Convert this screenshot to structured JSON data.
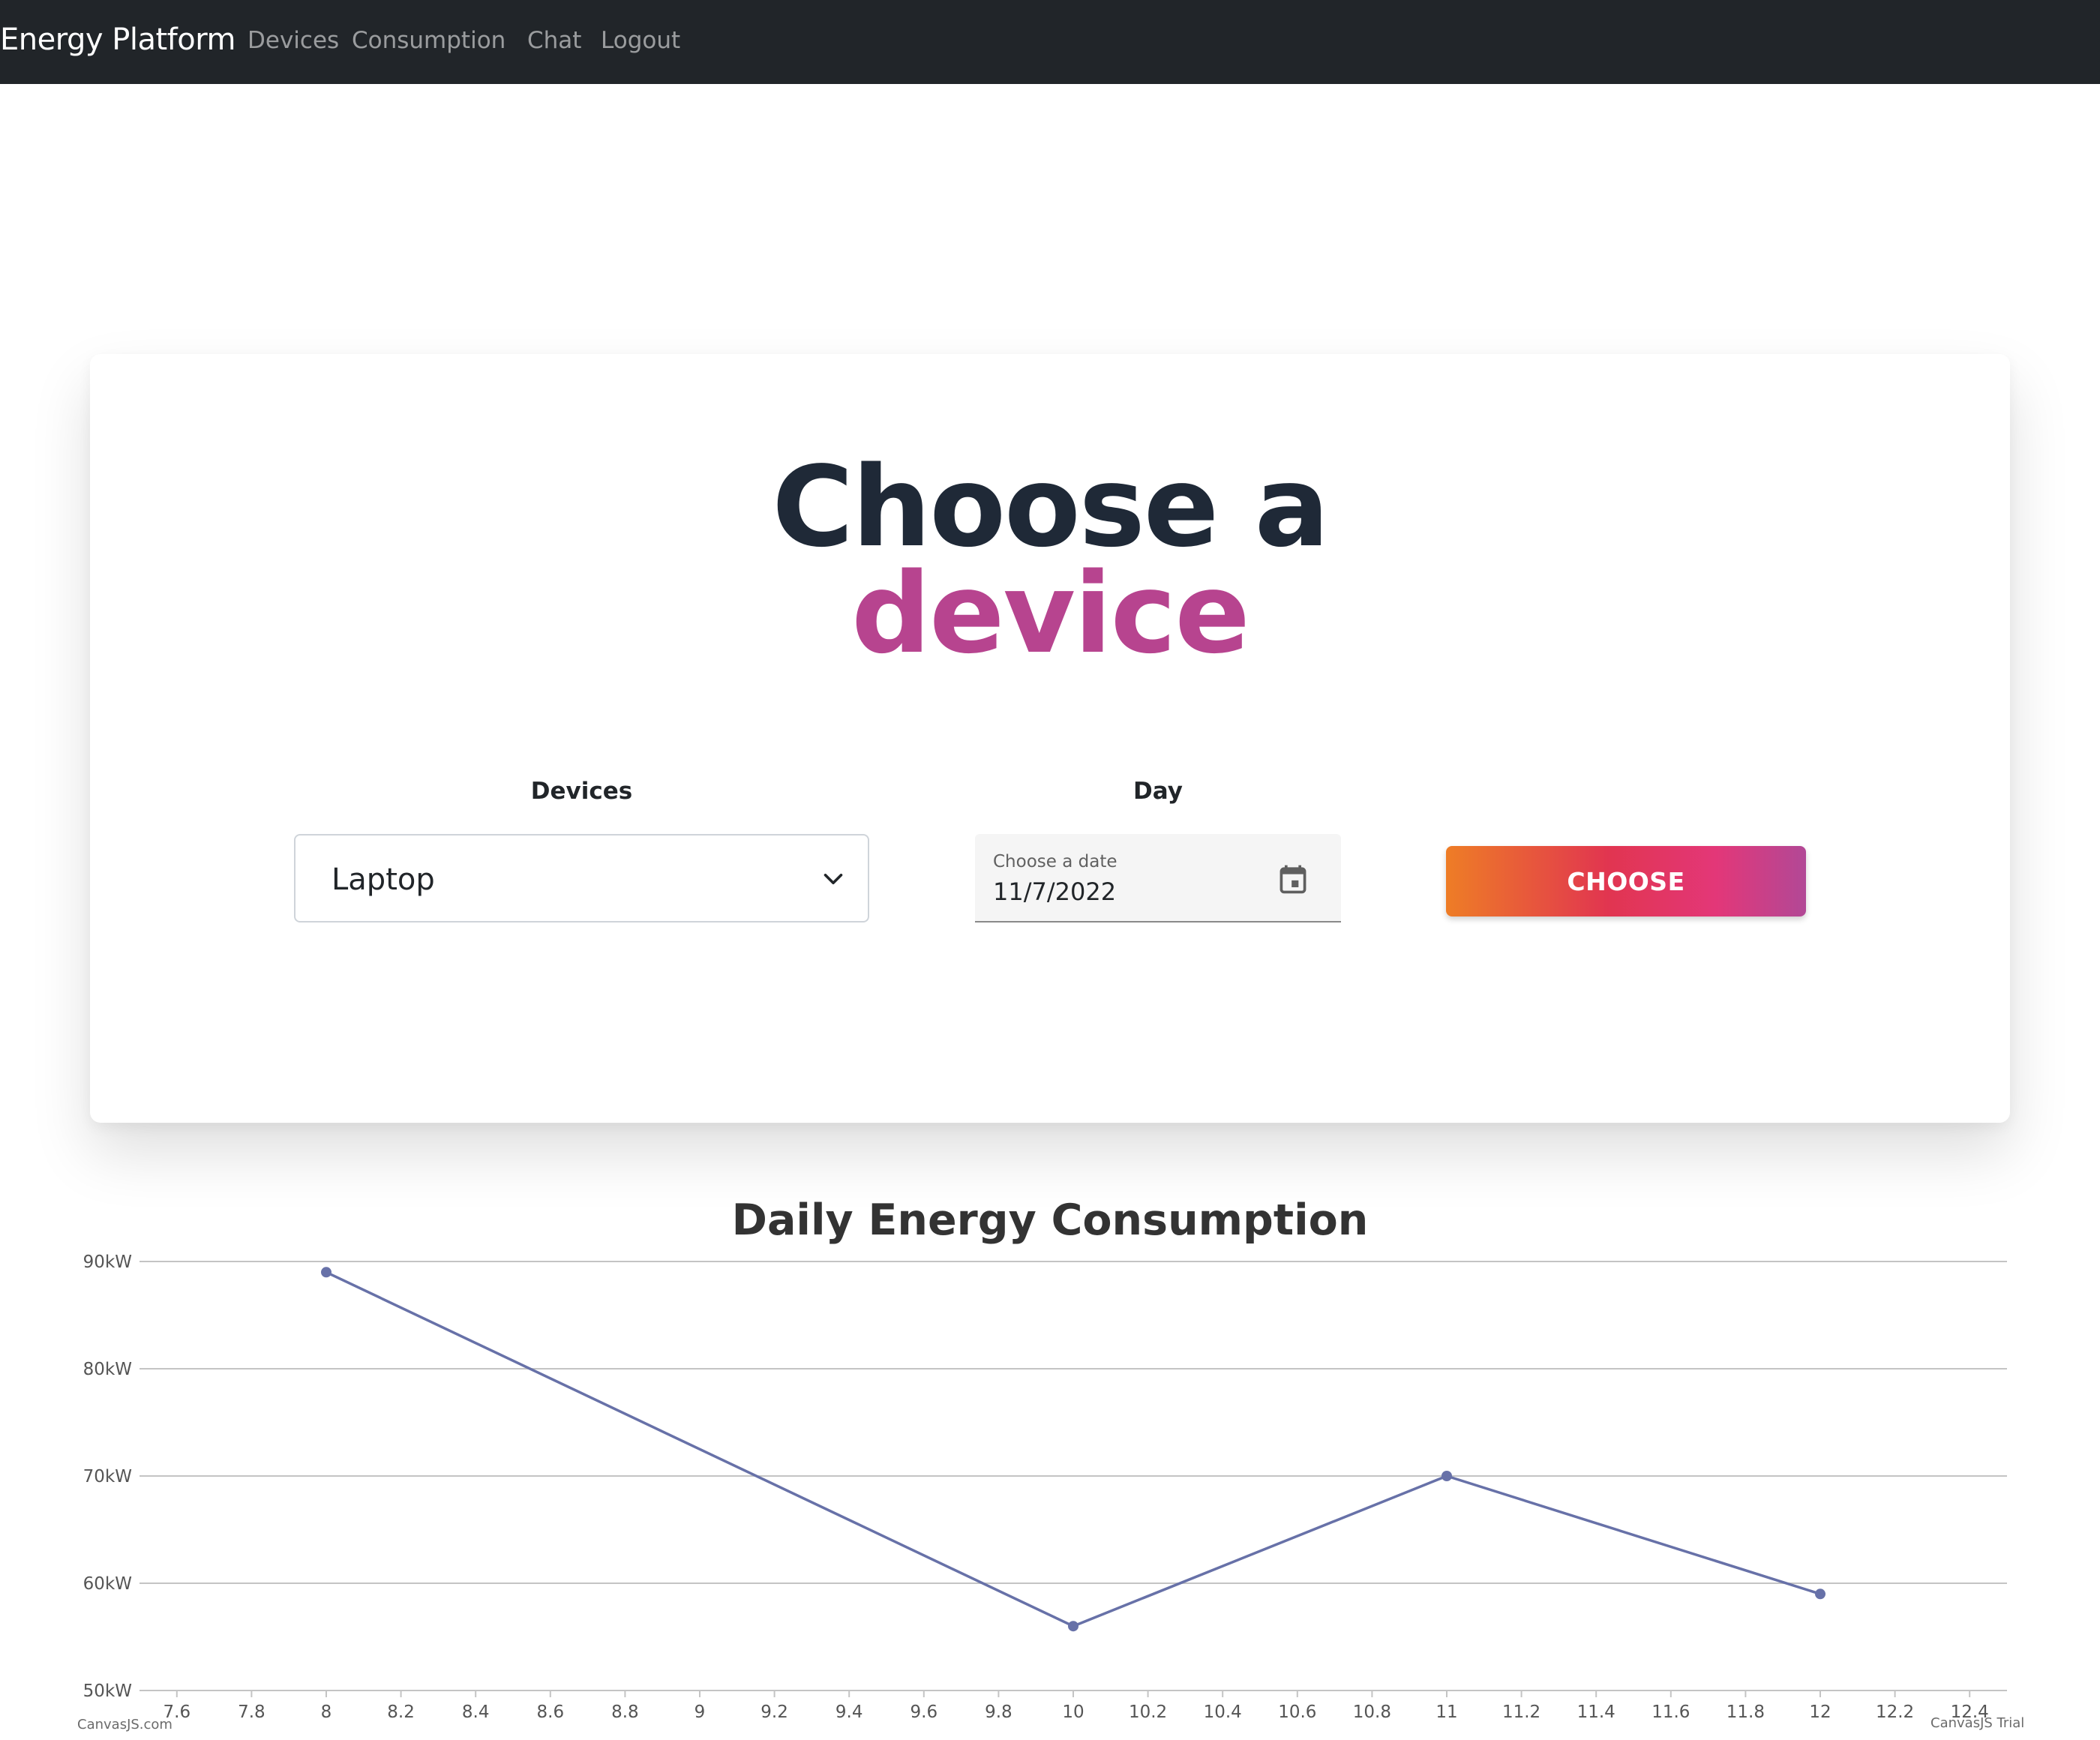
{
  "navbar": {
    "brand": "Energy Platform",
    "links": {
      "devices": "Devices",
      "consumption": "Consumption",
      "chat": "Chat",
      "logout": "Logout"
    }
  },
  "card": {
    "heading_line1": "Choose a",
    "heading_line2": "device",
    "devices_label": "Devices",
    "day_label": "Day",
    "device_select": {
      "selected": "Laptop"
    },
    "date_field": {
      "label": "Choose a date",
      "value": "11/7/2022"
    },
    "choose_button": "CHOOSE"
  },
  "colors": {
    "navbar": "#212529",
    "heading_dark": "#1f2937",
    "heading_accent": "#b7448f",
    "line": "#6771a8"
  },
  "icons": {
    "select_arrow": "chevron-down-icon",
    "date_picker": "calendar-icon"
  },
  "watermarks": {
    "left": "CanvasJS.com",
    "right": "CanvasJS Trial"
  },
  "chart_data": {
    "type": "line",
    "title": "Daily Energy Consumption",
    "xlabel": "",
    "ylabel": "",
    "x": [
      8,
      10,
      11,
      12
    ],
    "series": [
      {
        "values": [
          89,
          56,
          70,
          59
        ]
      }
    ],
    "xlim": [
      7.5,
      12.5
    ],
    "ylim": [
      50,
      90
    ],
    "x_ticks": [
      "7.6",
      "7.8",
      "8",
      "8.2",
      "8.4",
      "8.6",
      "8.8",
      "9",
      "9.2",
      "9.4",
      "9.6",
      "9.8",
      "10",
      "10.2",
      "10.4",
      "10.6",
      "10.8",
      "11",
      "11.2",
      "11.4",
      "11.6",
      "11.8",
      "12",
      "12.2",
      "12.4"
    ],
    "y_ticks": [
      "50kW",
      "60kW",
      "70kW",
      "80kW",
      "90kW"
    ],
    "grid": true,
    "legend": "none"
  }
}
